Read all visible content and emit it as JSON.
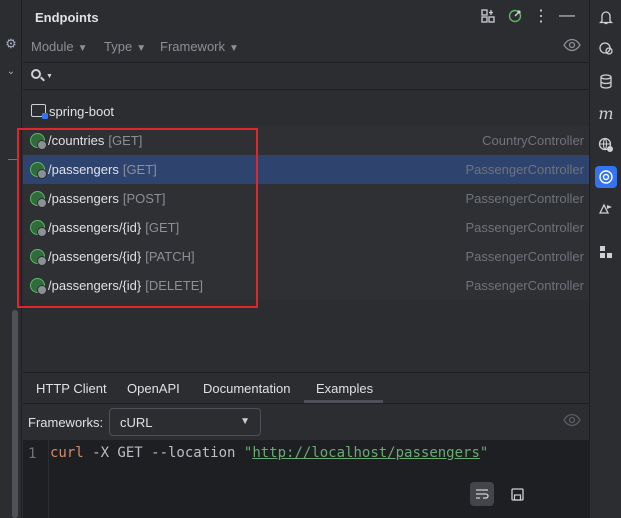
{
  "panel": {
    "title": "Endpoints"
  },
  "filters": {
    "module": "Module",
    "type": "Type",
    "framework": "Framework"
  },
  "search": {
    "value": "",
    "placeholder": ""
  },
  "module_name": "spring-boot",
  "endpoints": [
    {
      "path": "/countries",
      "method": "[GET]",
      "controller": "CountryController",
      "selected": false
    },
    {
      "path": "/passengers",
      "method": "[GET]",
      "controller": "PassengerController",
      "selected": true
    },
    {
      "path": "/passengers",
      "method": "[POST]",
      "controller": "PassengerController",
      "selected": false
    },
    {
      "path": "/passengers/{id}",
      "method": "[GET]",
      "controller": "PassengerController",
      "selected": false
    },
    {
      "path": "/passengers/{id}",
      "method": "[PATCH]",
      "controller": "PassengerController",
      "selected": false
    },
    {
      "path": "/passengers/{id}",
      "method": "[DELETE]",
      "controller": "PassengerController",
      "selected": false
    }
  ],
  "tabs": [
    {
      "label": "HTTP Client"
    },
    {
      "label": "OpenAPI"
    },
    {
      "label": "Documentation"
    },
    {
      "label": "Examples",
      "active": true
    }
  ],
  "frameworks": {
    "label": "Frameworks:",
    "selected": "cURL"
  },
  "editor": {
    "line_number": "1",
    "cmd": "curl",
    "args": " -X GET --location ",
    "quote_open": "\"",
    "url": "http://localhost/passengers",
    "quote_close": "\""
  },
  "colors": {
    "selected_row": "#2e436e",
    "highlight_box": "#e0262d",
    "accent": "#3574f0"
  }
}
